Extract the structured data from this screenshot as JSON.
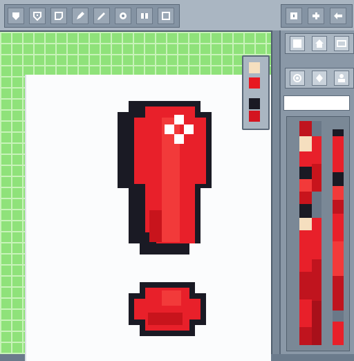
{
  "app": {
    "name_field_value": ""
  },
  "toolbar": {
    "left_tools": [
      {
        "icon": "shield-icon"
      },
      {
        "icon": "select-shield-icon"
      },
      {
        "icon": "shape-icon"
      },
      {
        "icon": "pencil-icon"
      },
      {
        "icon": "brush-icon"
      },
      {
        "icon": "gear-icon"
      },
      {
        "icon": "layers-icon"
      },
      {
        "icon": "square-icon"
      }
    ],
    "right_tools": [
      {
        "icon": "frame-icon"
      },
      {
        "icon": "puzzle-icon"
      },
      {
        "icon": "arrow-left-icon"
      }
    ]
  },
  "mini_palette": {
    "swatches": [
      "#f5dfbf",
      "#e81820",
      "#1a1a24",
      "#d41420"
    ]
  },
  "panel": {
    "row1_icons": [
      "note-icon",
      "house-icon",
      "rectangle-icon"
    ],
    "row2_icons": [
      "eye-icon",
      "diamond-icon",
      "person-icon"
    ]
  },
  "colors": {
    "accent_red": "#e8202a",
    "outline": "#1a1a24",
    "canvas_green": "#8fe27a",
    "panel_gray": "#8a98a7"
  }
}
